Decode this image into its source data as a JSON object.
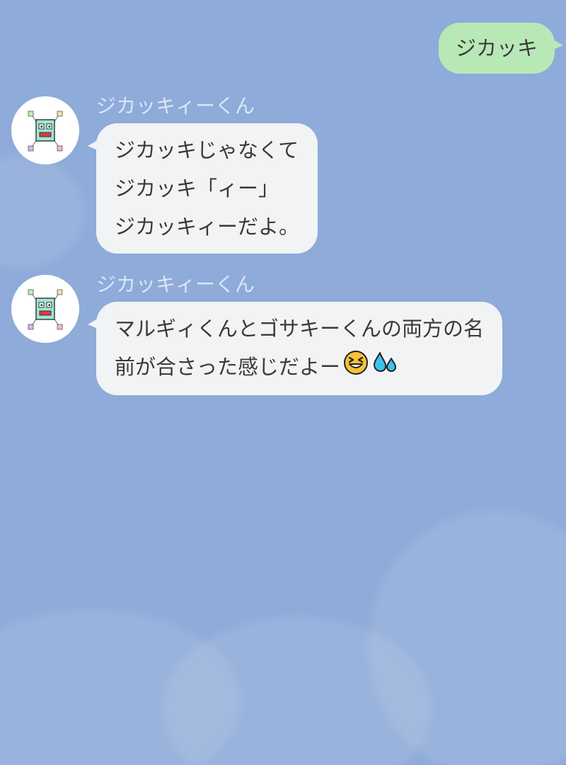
{
  "colors": {
    "background": "#8eabd9",
    "outgoing_bubble": "#b8e8b6",
    "incoming_bubble": "#f2f3f5",
    "sender_name": "#dbe6f7",
    "text": "#3a3a3a"
  },
  "messages": [
    {
      "direction": "outgoing",
      "text": "ジカッキ"
    },
    {
      "direction": "incoming",
      "sender": "ジカッキィーくん",
      "avatar_icon": "robot-face-icon",
      "lines": [
        "ジカッキじゃなくて",
        "ジカッキ「ィー」",
        "ジカッキィーだよ。"
      ]
    },
    {
      "direction": "incoming",
      "sender": "ジカッキィーくん",
      "avatar_icon": "robot-face-icon",
      "lines": [
        "マルギィくんとゴサキーくんの両方の名",
        "前が合さった感じだよー"
      ],
      "emojis": [
        "laughing-squint-face-emoji",
        "sweat-droplets-emoji"
      ]
    }
  ]
}
